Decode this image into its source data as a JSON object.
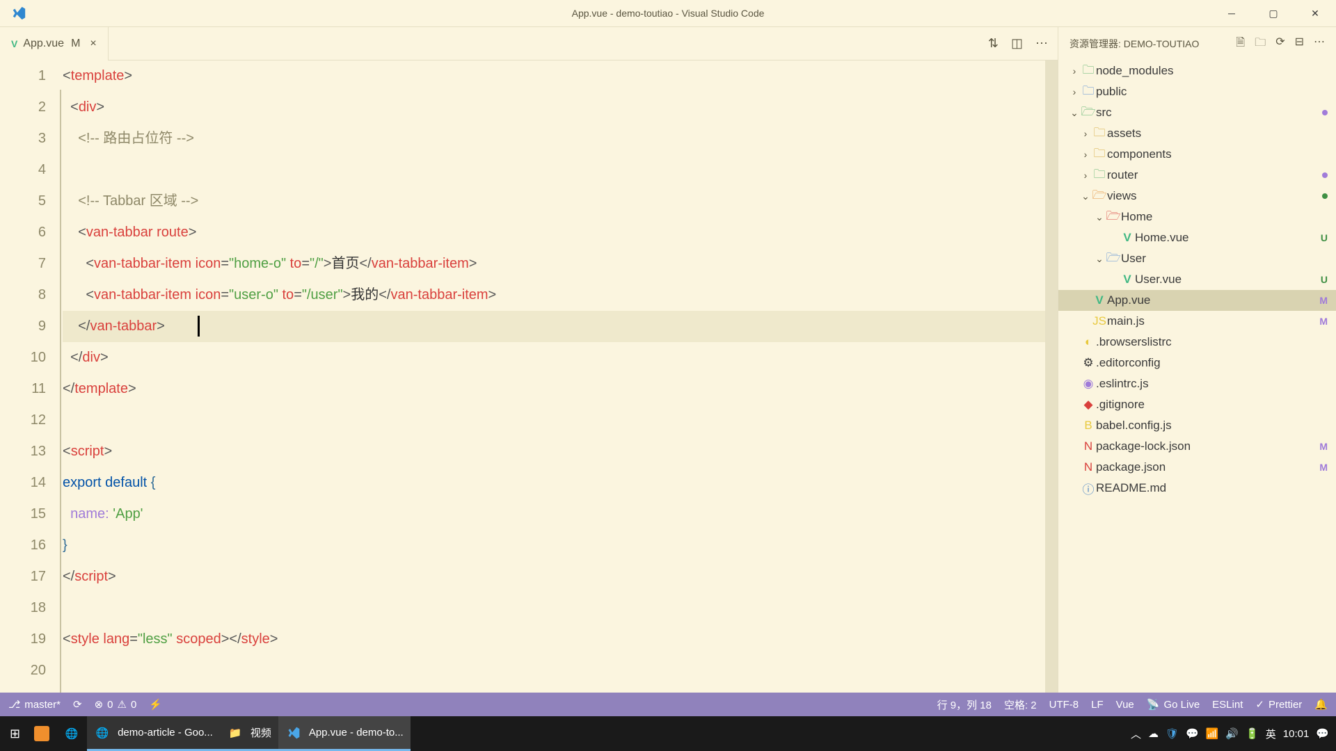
{
  "title_bar": {
    "title": "App.vue - demo-toutiao - Visual Studio Code"
  },
  "tab": {
    "file_icon": "V",
    "name": "App.vue",
    "modifier": "M",
    "close": "×"
  },
  "editor": {
    "lines": [
      "1",
      "2",
      "3",
      "4",
      "5",
      "6",
      "7",
      "8",
      "9",
      "10",
      "11",
      "12",
      "13",
      "14",
      "15",
      "16",
      "17",
      "18",
      "19",
      "20"
    ]
  },
  "code": {
    "l1_open": "<",
    "l1_tag": "template",
    "l1_close": ">",
    "l2_open": "<",
    "l2_tag": "div",
    "l2_close": ">",
    "l3_cm": "<!-- 路由占位符 -->",
    "l5_cm": "<!-- Tabbar 区域 -->",
    "l6_open": "<",
    "l6_tag": "van-tabbar",
    "l6_attr": "route",
    "l6_close": ">",
    "l7_open": "<",
    "l7_tag": "van-tabbar-item",
    "l7_a1": "icon",
    "l7_eq": "=",
    "l7_v1": "\"home-o\"",
    "l7_a2": "to",
    "l7_v2": "\"/\"",
    "l7_gt": ">",
    "l7_txt": "首页",
    "l7_co": "</",
    "l7_ctag": "van-tabbar-item",
    "l7_cgt": ">",
    "l8_open": "<",
    "l8_tag": "van-tabbar-item",
    "l8_a1": "icon",
    "l8_v1": "\"user-o\"",
    "l8_a2": "to",
    "l8_v2": "\"/user\"",
    "l8_txt": "我的",
    "l8_co": "</",
    "l8_ctag": "van-tabbar-item",
    "l9_co": "</",
    "l9_tag": "van-tabbar",
    "l9_gt": ">",
    "l10_co": "</",
    "l10_tag": "div",
    "l10_gt": ">",
    "l11_co": "</",
    "l11_tag": "template",
    "l11_gt": ">",
    "l13_o": "<",
    "l13_tag": "script",
    "l13_c": ">",
    "l14_a": "export",
    "l14_b": "default",
    "l14_brace": "{",
    "l15_k": "name:",
    "l15_v": "'App'",
    "l16_brace": "}",
    "l17_co": "</",
    "l17_tag": "script",
    "l17_gt": ">",
    "l19_o": "<",
    "l19_tag": "style",
    "l19_a1": "lang",
    "l19_v1": "\"less\"",
    "l19_a2": "scoped",
    "l19_gt": ">",
    "l19_co": "</",
    "l19_ctag": "style",
    "l19_cgt": ">"
  },
  "side": {
    "title": "资源管理器: DEMO-TOUTIAO",
    "items": {
      "node_modules": "node_modules",
      "public": "public",
      "src": "src",
      "assets": "assets",
      "components": "components",
      "router": "router",
      "views": "views",
      "home": "Home",
      "home_vue": "Home.vue",
      "user": "User",
      "user_vue": "User.vue",
      "app_vue": "App.vue",
      "main_js": "main.js",
      "browserslistrc": ".browserslistrc",
      "editorconfig": ".editorconfig",
      "eslintrc": ".eslintrc.js",
      "gitignore": ".gitignore",
      "babel": "babel.config.js",
      "pkglock": "package-lock.json",
      "pkg": "package.json",
      "readme": "README.md"
    },
    "badges": {
      "m": "M",
      "u": "U"
    }
  },
  "statusbar": {
    "branch": "master*",
    "sync": "⟳",
    "errors": "0",
    "warnings": "0",
    "cursor": "行 9，列 18",
    "spaces": "空格: 2",
    "encoding": "UTF-8",
    "eol": "LF",
    "lang": "Vue",
    "golive": "Go Live",
    "eslint": "ESLint",
    "prettier": "Prettier"
  },
  "taskbar": {
    "chrome": "demo-article - Goo...",
    "folder": "视频",
    "vscode": "App.vue - demo-to...",
    "ime": "英",
    "time": "10:01"
  }
}
